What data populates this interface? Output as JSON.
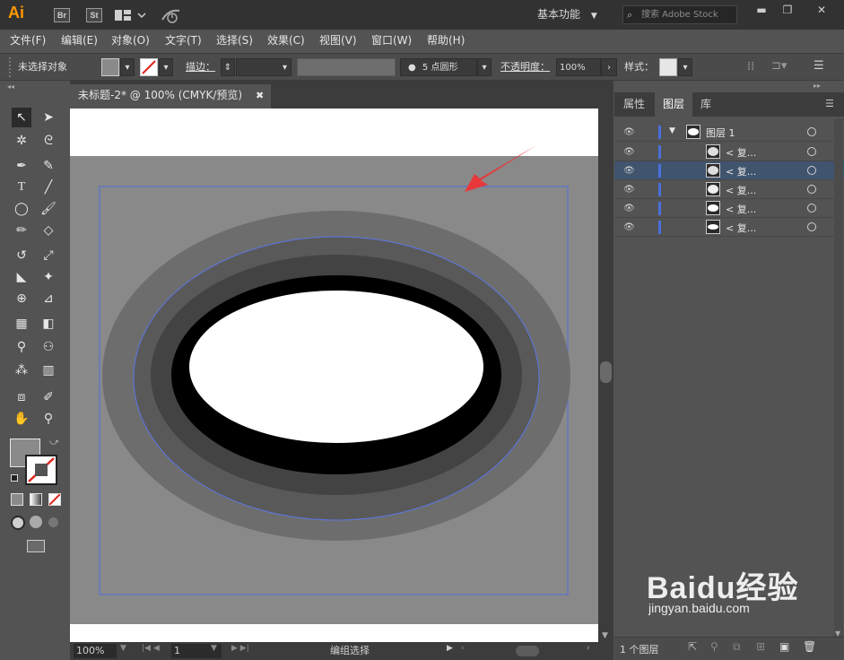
{
  "app": {
    "logo": "Ai",
    "bridge": "Br",
    "stock": "St",
    "workspace": "基本功能",
    "search_placeholder": "搜索 Adobe Stock"
  },
  "menu": [
    "文件(F)",
    "编辑(E)",
    "对象(O)",
    "文字(T)",
    "选择(S)",
    "效果(C)",
    "视图(V)",
    "窗口(W)",
    "帮助(H)"
  ],
  "control": {
    "selection_status": "未选择对象",
    "stroke_label": "描边：",
    "brush": "5 点圆形",
    "opacity_label": "不透明度：",
    "opacity_value": "100%",
    "style_label": "样式："
  },
  "document": {
    "tab_title": "未标题-2* @ 100% (CMYK/预览)",
    "zoom": "100%",
    "artboard_number": "1",
    "status": "编组选择"
  },
  "panel": {
    "tabs": [
      "属性",
      "图层",
      "库"
    ],
    "layer_name": "图层 1",
    "sublayers": [
      "< 复...",
      "< 复...",
      "< 复...",
      "< 复...",
      "< 复..."
    ],
    "footer": "1 个图层"
  },
  "watermark": {
    "brand": "Baidu经验",
    "url": "jingyan.baidu.com"
  },
  "colors": {
    "accent": "#4a6fdc",
    "arrow": "#e8383b",
    "logo": "#ff9a00"
  }
}
